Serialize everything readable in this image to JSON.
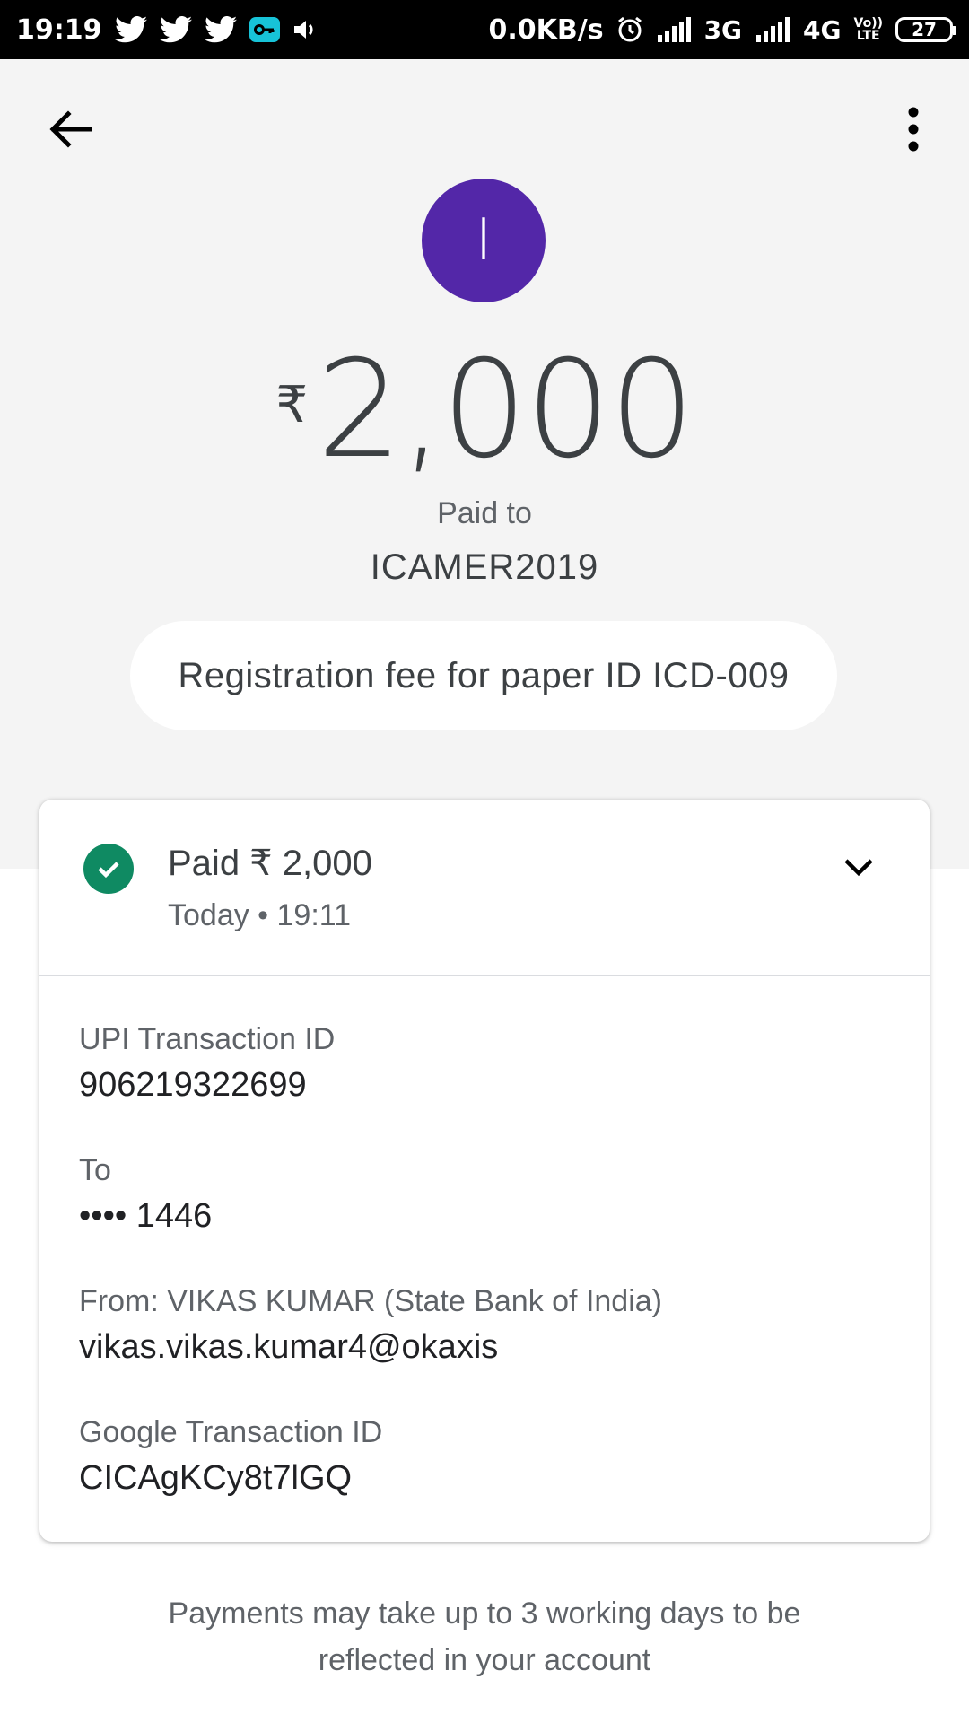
{
  "status_bar": {
    "time": "19:19",
    "net_speed": "0.0KB/s",
    "net_3g": "3G",
    "net_4g": "4G",
    "volte_top": "Vo))",
    "volte_bottom": "LTE",
    "battery": "27",
    "icons": [
      "twitter-icon",
      "twitter-icon",
      "twitter-icon",
      "vpn-key-icon",
      "volume-icon",
      "alarm-icon",
      "signal-icon",
      "signal-icon"
    ]
  },
  "header": {
    "back_icon": "arrow-back-icon",
    "menu_icon": "more-vert-icon"
  },
  "payment": {
    "avatar_initial": "I",
    "currency_symbol": "₹",
    "amount": "2,000",
    "paid_to_label": "Paid to",
    "payee": "ICAMER2019",
    "note": "Registration fee for paper ID ICD-009"
  },
  "card": {
    "status_title": "Paid ₹ 2,000",
    "status_time": "Today • 19:11",
    "details": [
      {
        "label": "UPI Transaction ID",
        "value": "906219322699"
      },
      {
        "label": "To",
        "value": "•••• 1446"
      },
      {
        "label": "From: VIKAS  KUMAR (State Bank of India)",
        "value": "vikas.vikas.kumar4@okaxis"
      },
      {
        "label": "Google Transaction ID",
        "value": "CICAgKCy8t7lGQ"
      }
    ]
  },
  "footer": {
    "line1": "Payments may take up to 3 working days to be",
    "line2": "reflected in your account"
  },
  "colors": {
    "avatar": "#5327a8",
    "success": "#0f8a62",
    "header_bg": "#f4f4f4"
  }
}
